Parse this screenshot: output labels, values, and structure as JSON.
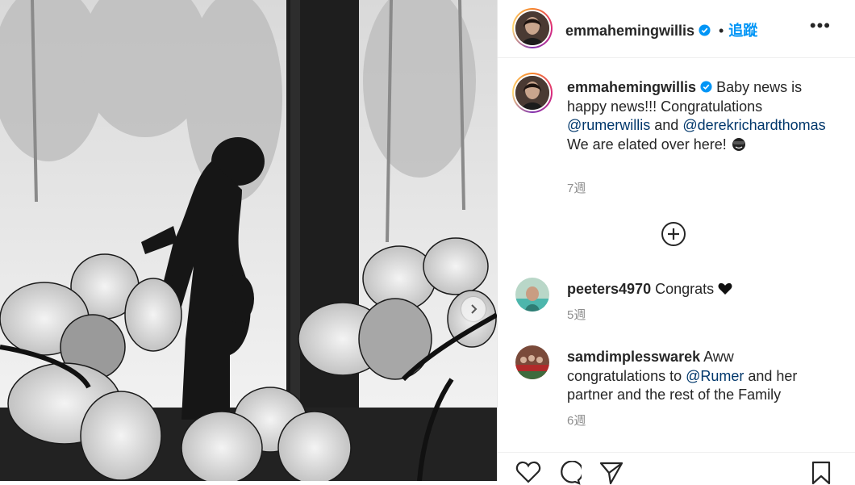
{
  "post": {
    "author": "emmahemingwillis",
    "follow_label": "追蹤",
    "dot": "•",
    "more_label": "•••"
  },
  "caption": {
    "author": "emmahemingwillis",
    "text_1": " Baby news is happy news!!! Congratulations ",
    "mention_1": "@rumerwillis",
    "text_2": " and ",
    "mention_2": "@derekrichardthomas",
    "text_3": " We are elated over here! ",
    "time": "7週"
  },
  "comments": [
    {
      "user": "peeters4970",
      "text_before": " Congrats ",
      "mention": "",
      "text_after": "",
      "time": "5週",
      "icon": "black-heart-icon"
    },
    {
      "user": "samdimplesswarek",
      "text_before": " Aww congratulations to ",
      "mention": "@Rumer",
      "text_after": " and her partner and the rest of the Family",
      "time": "6週"
    }
  ],
  "icons": {
    "verified": "verified-badge-icon",
    "load_more": "plus-circle-icon",
    "carousel": "chevron-right-icon",
    "like": "heart-icon",
    "comment": "comment-icon",
    "share": "paper-plane-icon",
    "save": "bookmark-icon",
    "emoji": "smiling-face-with-sunglasses-icon"
  },
  "colors": {
    "link": "#00376b",
    "follow": "#0095f6",
    "verified": "#0095f6",
    "secondary": "#8e8e8e"
  }
}
